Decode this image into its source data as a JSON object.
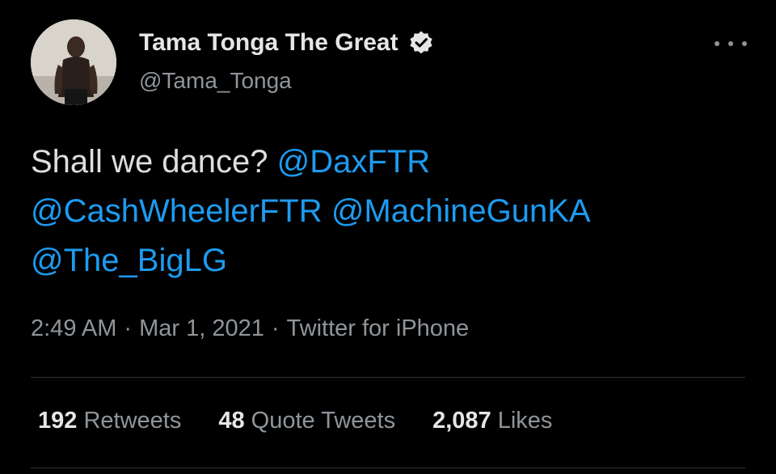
{
  "tweet": {
    "author": {
      "display_name": "Tama Tonga The Great",
      "handle": "@Tama_Tonga",
      "verified": true,
      "avatar_icon": "profile-photo-avatar"
    },
    "text_plain": "Shall we dance?",
    "mentions": [
      "@DaxFTR",
      "@CashWheelerFTR",
      "@MachineGunKA",
      "@The_BigLG"
    ],
    "meta": {
      "time": "2:49 AM",
      "separator": "·",
      "date": "Mar 1, 2021",
      "source": "Twitter for iPhone"
    },
    "stats": {
      "retweets": {
        "count": "192",
        "label": "Retweets"
      },
      "quote_tweets": {
        "count": "48",
        "label": "Quote Tweets"
      },
      "likes": {
        "count": "2,087",
        "label": "Likes"
      }
    }
  },
  "colors": {
    "background": "#000000",
    "mention": "#1d9bf0",
    "secondary_text": "#8f959a",
    "primary_text": "#e6e6e6",
    "divider": "#2f3336"
  }
}
